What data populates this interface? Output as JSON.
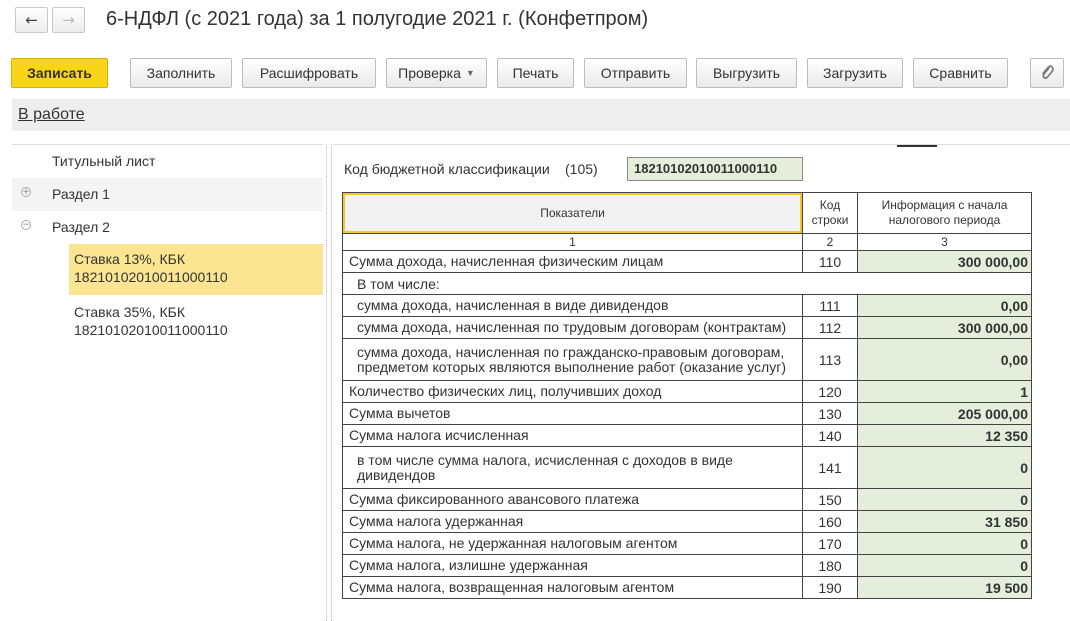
{
  "title": "6-НДФЛ (с 2021 года) за 1 полугодие 2021 г. (Конфетпром)",
  "nav": {
    "back_icon": "←",
    "forward_icon": "→"
  },
  "toolbar": {
    "save": "Записать",
    "fill": "Заполнить",
    "decode": "Расшифровать",
    "check": "Проверка",
    "print": "Печать",
    "send": "Отправить",
    "export": "Выгрузить",
    "import": "Загрузить",
    "compare": "Сравнить",
    "attach_icon": "paperclip-icon",
    "caret": "▼"
  },
  "status": {
    "label": "В работе"
  },
  "sidebar": {
    "title_page": "Титульный лист",
    "section1": "Раздел 1",
    "section2": "Раздел 2",
    "expand_symbol": "+",
    "collapse_symbol": "−",
    "sub_items": [
      {
        "line1": "Ставка 13%, КБК",
        "line2": "18210102010011000110"
      },
      {
        "line1": "Ставка 35%, КБК",
        "line2": "18210102010011000110"
      }
    ]
  },
  "form": {
    "kbk_label": "Код бюджетной классификации",
    "kbk_num": "(105)",
    "kbk_value": "18210102010011000110",
    "headers": {
      "indicators": "Показатели",
      "code_line1": "Код",
      "code_line2": "строки",
      "info_line1": "Информация с начала",
      "info_line2": "налогового периода"
    },
    "col_nums": [
      "1",
      "2",
      "3"
    ],
    "intro": "В том числе:",
    "rows": [
      {
        "label": "Сумма дохода, начисленная физическим лицам",
        "code": "110",
        "value": "300 000,00"
      },
      {
        "label": "сумма дохода, начисленная в виде дивидендов",
        "code": "111",
        "value": "0,00"
      },
      {
        "label": "сумма дохода, начисленная по трудовым договорам (контрактам)",
        "code": "112",
        "value": "300 000,00"
      },
      {
        "label": "сумма дохода, начисленная по гражданско-правовым договорам, предметом которых являются выполнение работ (оказание услуг)",
        "code": "113",
        "value": "0,00"
      },
      {
        "label": "Количество физических лиц, получивших доход",
        "code": "120",
        "value": "1"
      },
      {
        "label": "Сумма вычетов",
        "code": "130",
        "value": "205 000,00"
      },
      {
        "label": "Сумма налога исчисленная",
        "code": "140",
        "value": "12 350"
      },
      {
        "label": "в том числе сумма налога, исчисленная с доходов в виде дивидендов",
        "code": "141",
        "value": "0"
      },
      {
        "label": "Сумма фиксированного авансового платежа",
        "code": "150",
        "value": "0"
      },
      {
        "label": "Сумма налога удержанная",
        "code": "160",
        "value": "31 850"
      },
      {
        "label": "Сумма налога, не удержанная налоговым агентом",
        "code": "170",
        "value": "0"
      },
      {
        "label": "Сумма налога, излишне удержанная",
        "code": "180",
        "value": "0"
      },
      {
        "label": "Сумма налога, возвращенная налоговым агентом",
        "code": "190",
        "value": "19 500"
      }
    ]
  }
}
